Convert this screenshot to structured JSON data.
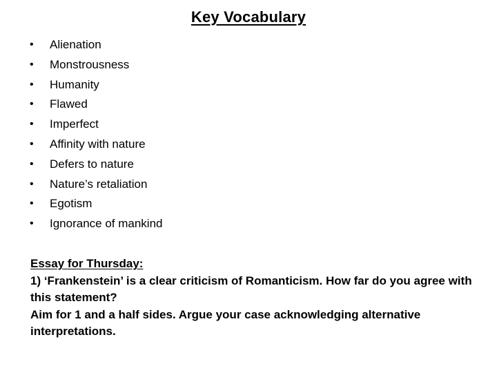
{
  "title": "Key Vocabulary",
  "vocabulary": [
    "Alienation",
    "Monstrousness",
    "Humanity",
    "Flawed",
    "Imperfect",
    "Affinity with nature",
    "Defers to nature",
    "Nature’s retaliation",
    "Egotism",
    "Ignorance of mankind"
  ],
  "bullet_glyph": "•",
  "essay": {
    "heading": "Essay for Thursday:",
    "question": "1) ‘Frankenstein’ is a clear criticism of Romanticism. How far do you agree with this statement?",
    "instructions": "Aim for 1 and a half sides. Argue your case acknowledging alternative interpretations."
  }
}
